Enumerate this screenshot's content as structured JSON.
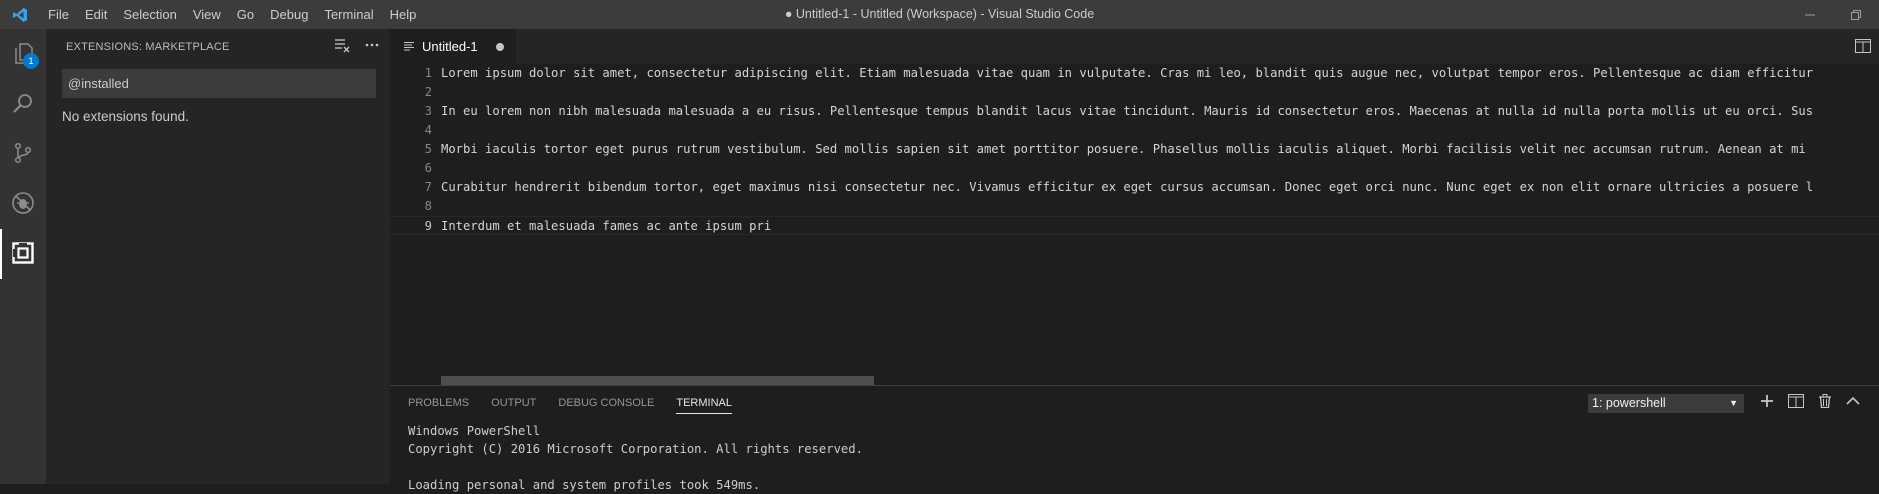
{
  "titlebar": {
    "menu": [
      "File",
      "Edit",
      "Selection",
      "View",
      "Go",
      "Debug",
      "Terminal",
      "Help"
    ],
    "window_title": "● Untitled-1 - Untitled (Workspace) - Visual Studio Code",
    "controls": [
      "minimize-icon",
      "restore-icon"
    ]
  },
  "activitybar": {
    "items": [
      "explorer-icon",
      "search-icon",
      "source-control-icon",
      "debug-icon",
      "extensions-icon"
    ],
    "explorer_badge": "1",
    "active": "extensions"
  },
  "sidebar": {
    "title": "EXTENSIONS: MARKETPLACE",
    "search_value": "@installed",
    "empty_message": "No extensions found."
  },
  "editor": {
    "tab_label": "Untitled-1",
    "lines": [
      {
        "n": "1",
        "text": "Lorem ipsum dolor sit amet, consectetur adipiscing elit. Etiam malesuada vitae quam in vulputate. Cras mi leo, blandit quis augue nec, volutpat tempor eros. Pellentesque ac diam efficitur"
      },
      {
        "n": "2",
        "text": ""
      },
      {
        "n": "3",
        "text": "In eu lorem non nibh malesuada malesuada a eu risus. Pellentesque tempus blandit lacus vitae tincidunt. Mauris id consectetur eros. Maecenas at nulla id nulla porta mollis ut eu orci. Sus"
      },
      {
        "n": "4",
        "text": ""
      },
      {
        "n": "5",
        "text": "Morbi iaculis tortor eget purus rutrum vestibulum. Sed mollis sapien sit amet porttitor posuere. Phasellus mollis iaculis aliquet. Morbi facilisis velit nec accumsan rutrum. Aenean at mi"
      },
      {
        "n": "6",
        "text": ""
      },
      {
        "n": "7",
        "text": "Curabitur hendrerit bibendum tortor, eget maximus nisi consectetur nec. Vivamus efficitur ex eget cursus accumsan. Donec eget orci nunc. Nunc eget ex non elit ornare ultricies a posuere l"
      },
      {
        "n": "8",
        "text": ""
      },
      {
        "n": "9",
        "text": "Interdum et malesuada fames ac ante ipsum pri"
      }
    ]
  },
  "panel": {
    "tabs": [
      "PROBLEMS",
      "OUTPUT",
      "DEBUG CONSOLE",
      "TERMINAL"
    ],
    "active_tab": "TERMINAL",
    "terminal_select": "1: powershell",
    "terminal_lines": [
      "Windows PowerShell",
      "Copyright (C) 2016 Microsoft Corporation. All rights reserved.",
      "",
      "Loading personal and system profiles took 549ms."
    ]
  },
  "colors": {
    "accent": "#007acc",
    "titlebar_bg": "#3c3c3c",
    "activitybar_bg": "#333333",
    "sidebar_bg": "#252526",
    "editor_bg": "#1e1e1e"
  }
}
